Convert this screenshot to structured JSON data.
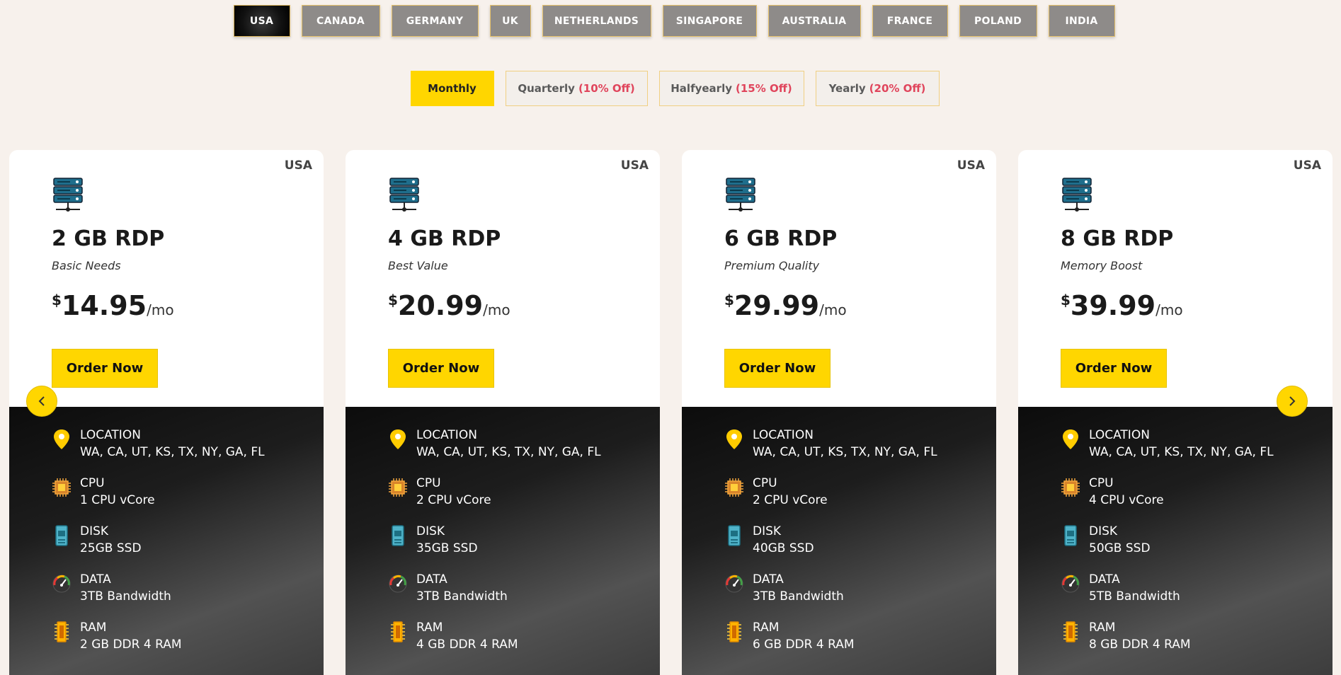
{
  "countries": [
    {
      "label": "USA",
      "active": true
    },
    {
      "label": "CANADA"
    },
    {
      "label": "GERMANY"
    },
    {
      "label": "UK"
    },
    {
      "label": "NETHERLANDS"
    },
    {
      "label": "SINGAPORE"
    },
    {
      "label": "AUSTRALIA"
    },
    {
      "label": "FRANCE"
    },
    {
      "label": "POLAND"
    },
    {
      "label": "INDIA"
    }
  ],
  "billing": [
    {
      "label": "Monthly",
      "off": "",
      "active": true
    },
    {
      "label": "Quarterly",
      "off": "(10% Off)"
    },
    {
      "label": "Halfyearly",
      "off": "(15% Off)"
    },
    {
      "label": "Yearly",
      "off": "(20% Off)"
    }
  ],
  "spec_labels": {
    "location": "LOCATION",
    "cpu": "CPU",
    "disk": "DISK",
    "data": "DATA",
    "ram": "RAM"
  },
  "plans": [
    {
      "region": "USA",
      "title": "2 GB RDP",
      "subtitle": "Basic Needs",
      "currency": "$",
      "price": "14.95",
      "period": "/mo",
      "order": "Order Now",
      "location": "WA, CA, UT, KS, TX, NY, GA, FL",
      "cpu": "1 CPU vCore",
      "disk": "25GB SSD",
      "data": "3TB Bandwidth",
      "ram": "2 GB DDR 4 RAM"
    },
    {
      "region": "USA",
      "title": "4 GB RDP",
      "subtitle": "Best Value",
      "currency": "$",
      "price": "20.99",
      "period": "/mo",
      "order": "Order Now",
      "location": "WA, CA, UT, KS, TX, NY, GA, FL",
      "cpu": "2 CPU vCore",
      "disk": "35GB SSD",
      "data": "3TB Bandwidth",
      "ram": "4 GB DDR 4 RAM"
    },
    {
      "region": "USA",
      "title": "6 GB RDP",
      "subtitle": "Premium Quality",
      "currency": "$",
      "price": "29.99",
      "period": "/mo",
      "order": "Order Now",
      "location": "WA, CA, UT, KS, TX, NY, GA, FL",
      "cpu": "2 CPU vCore",
      "disk": "40GB SSD",
      "data": "3TB Bandwidth",
      "ram": "6 GB DDR 4 RAM"
    },
    {
      "region": "USA",
      "title": "8 GB RDP",
      "subtitle": "Memory Boost",
      "currency": "$",
      "price": "39.99",
      "period": "/mo",
      "order": "Order Now",
      "location": "WA, CA, UT, KS, TX, NY, GA, FL",
      "cpu": "4 CPU vCore",
      "disk": "50GB SSD",
      "data": "5TB Bandwidth",
      "ram": "8 GB DDR 4 RAM"
    }
  ],
  "colors": {
    "accent": "#ffd600",
    "discount": "#e0455c",
    "background": "#f7f1ec"
  }
}
